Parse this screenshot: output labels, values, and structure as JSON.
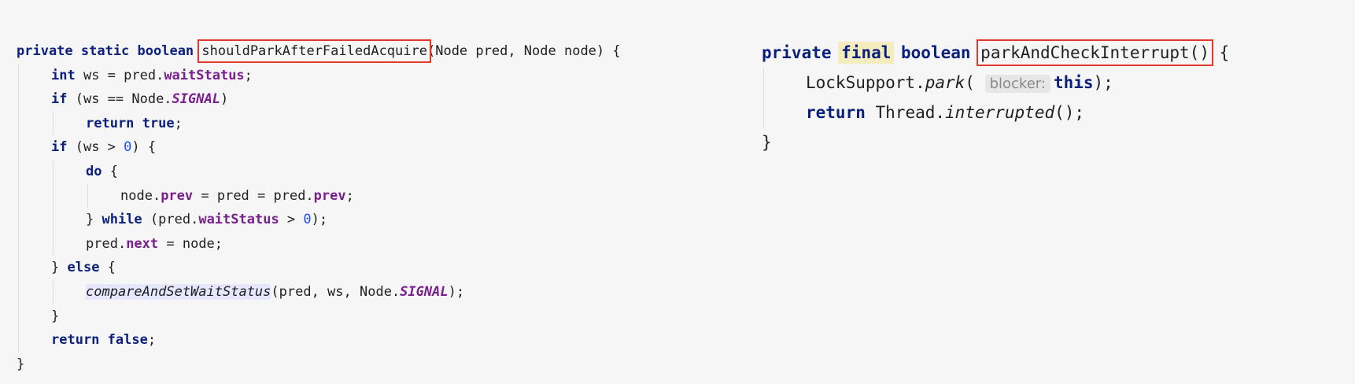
{
  "left_method": {
    "lines": [
      {
        "indent": 0,
        "tokens": [
          {
            "t": "private static boolean ",
            "c": "kw"
          },
          {
            "t": "shouldParkAfterFailedAcquire",
            "c": "plain",
            "boxed": true
          },
          {
            "t": "(Node pred, Node node) {",
            "c": "plain"
          }
        ]
      },
      {
        "indent": 1,
        "tokens": [
          {
            "t": "int ",
            "c": "kw"
          },
          {
            "t": "ws = pred.",
            "c": "plain"
          },
          {
            "t": "waitStatus",
            "c": "field"
          },
          {
            "t": ";",
            "c": "plain"
          }
        ]
      },
      {
        "indent": 1,
        "tokens": [
          {
            "t": "if ",
            "c": "kw"
          },
          {
            "t": "(ws == Node.",
            "c": "plain"
          },
          {
            "t": "SIGNAL",
            "c": "const"
          },
          {
            "t": ")",
            "c": "plain"
          }
        ]
      },
      {
        "indent": 2,
        "tokens": [
          {
            "t": "return true",
            "c": "kw"
          },
          {
            "t": ";",
            "c": "plain"
          }
        ]
      },
      {
        "indent": 1,
        "tokens": [
          {
            "t": "if ",
            "c": "kw"
          },
          {
            "t": "(ws > ",
            "c": "plain"
          },
          {
            "t": "0",
            "c": "num"
          },
          {
            "t": ") {",
            "c": "plain"
          }
        ]
      },
      {
        "indent": 2,
        "tokens": [
          {
            "t": "do ",
            "c": "kw"
          },
          {
            "t": "{",
            "c": "plain"
          }
        ]
      },
      {
        "indent": 3,
        "tokens": [
          {
            "t": "node.",
            "c": "plain"
          },
          {
            "t": "prev",
            "c": "field"
          },
          {
            "t": " = pred = pred.",
            "c": "plain"
          },
          {
            "t": "prev",
            "c": "field"
          },
          {
            "t": ";",
            "c": "plain"
          }
        ]
      },
      {
        "indent": 2,
        "tokens": [
          {
            "t": "} ",
            "c": "plain"
          },
          {
            "t": "while ",
            "c": "kw"
          },
          {
            "t": "(pred.",
            "c": "plain"
          },
          {
            "t": "waitStatus",
            "c": "field"
          },
          {
            "t": " > ",
            "c": "plain"
          },
          {
            "t": "0",
            "c": "num"
          },
          {
            "t": ");",
            "c": "plain"
          }
        ]
      },
      {
        "indent": 2,
        "tokens": [
          {
            "t": "pred.",
            "c": "plain"
          },
          {
            "t": "next",
            "c": "field"
          },
          {
            "t": " = node;",
            "c": "plain"
          }
        ]
      },
      {
        "indent": 1,
        "tokens": [
          {
            "t": "} ",
            "c": "plain"
          },
          {
            "t": "else ",
            "c": "kw"
          },
          {
            "t": "{",
            "c": "plain"
          }
        ]
      },
      {
        "indent": 2,
        "tokens": [
          {
            "t": "compareAndSetWaitStatus",
            "c": "italic",
            "selected": true
          },
          {
            "t": "(pred, ws, Node.",
            "c": "plain"
          },
          {
            "t": "SIGNAL",
            "c": "const"
          },
          {
            "t": ");",
            "c": "plain"
          }
        ]
      },
      {
        "indent": 1,
        "tokens": [
          {
            "t": "}",
            "c": "plain"
          }
        ]
      },
      {
        "indent": 1,
        "tokens": [
          {
            "t": "return false",
            "c": "kw"
          },
          {
            "t": ";",
            "c": "plain"
          }
        ]
      },
      {
        "indent": 0,
        "tokens": [
          {
            "t": "}",
            "c": "plain"
          }
        ]
      }
    ]
  },
  "right_method": {
    "lines": [
      {
        "indent": 0,
        "tokens": [
          {
            "t": "private ",
            "c": "kw"
          },
          {
            "t": "final",
            "c": "kw",
            "highlight": true
          },
          {
            "t": " boolean ",
            "c": "kw"
          },
          {
            "t": "parkAndCheckInterrupt()",
            "c": "plain",
            "boxed": true
          },
          {
            "t": " {",
            "c": "plain"
          }
        ]
      },
      {
        "indent": 1,
        "tokens": [
          {
            "t": "LockSupport.",
            "c": "plain"
          },
          {
            "t": "park",
            "c": "italic"
          },
          {
            "t": "( ",
            "c": "plain"
          },
          {
            "t": "blocker:",
            "c": "hint"
          },
          {
            "t": "this",
            "c": "kw"
          },
          {
            "t": ");",
            "c": "plain"
          }
        ]
      },
      {
        "indent": 1,
        "tokens": [
          {
            "t": "return ",
            "c": "kw"
          },
          {
            "t": "Thread.",
            "c": "plain"
          },
          {
            "t": "interrupted",
            "c": "italic"
          },
          {
            "t": "();",
            "c": "plain"
          }
        ]
      },
      {
        "indent": 0,
        "tokens": [
          {
            "t": "}",
            "c": "plain"
          }
        ]
      }
    ]
  }
}
